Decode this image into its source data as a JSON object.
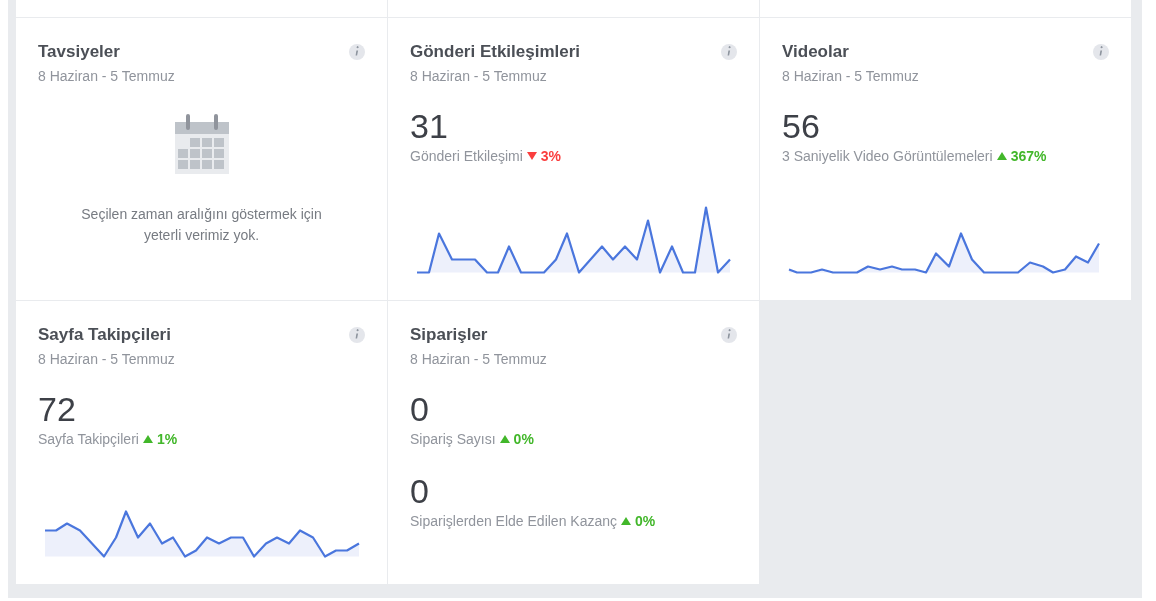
{
  "cards": [
    {
      "kind": "empty",
      "title": "Tavsiyeler",
      "date": "8 Haziran - 5 Temmuz",
      "message": "Seçilen zaman aralığını göstermek için yeterli verimiz yok."
    },
    {
      "kind": "metrics",
      "title": "Gönderi Etkileşimleri",
      "date": "8 Haziran - 5 Temmuz",
      "metrics": [
        {
          "value": "31",
          "label": "Gönderi Etkileşimi",
          "rising": false,
          "change": "3%"
        }
      ]
    },
    {
      "kind": "metrics",
      "title": "Videolar",
      "date": "8 Haziran - 5 Temmuz",
      "metrics": [
        {
          "value": "56",
          "label": "3 Saniyelik Video Görüntülemeleri",
          "rising": true,
          "change": "367%"
        }
      ]
    },
    {
      "kind": "metrics",
      "title": "Sayfa Takipçileri",
      "date": "8 Haziran - 5 Temmuz",
      "metrics": [
        {
          "value": "72",
          "label": "Sayfa Takipçileri",
          "rising": true,
          "change": "1%"
        }
      ]
    },
    {
      "kind": "counts",
      "title": "Siparişler",
      "date": "8 Haziran - 5 Temmuz",
      "metrics": [
        {
          "value": "0",
          "label": "Sipariş Sayısı",
          "rising": true,
          "change": "0%"
        },
        {
          "value": "0",
          "label": "Siparişlerden Elde Edilen Kazanç",
          "rising": true,
          "change": "0%"
        }
      ]
    }
  ]
}
